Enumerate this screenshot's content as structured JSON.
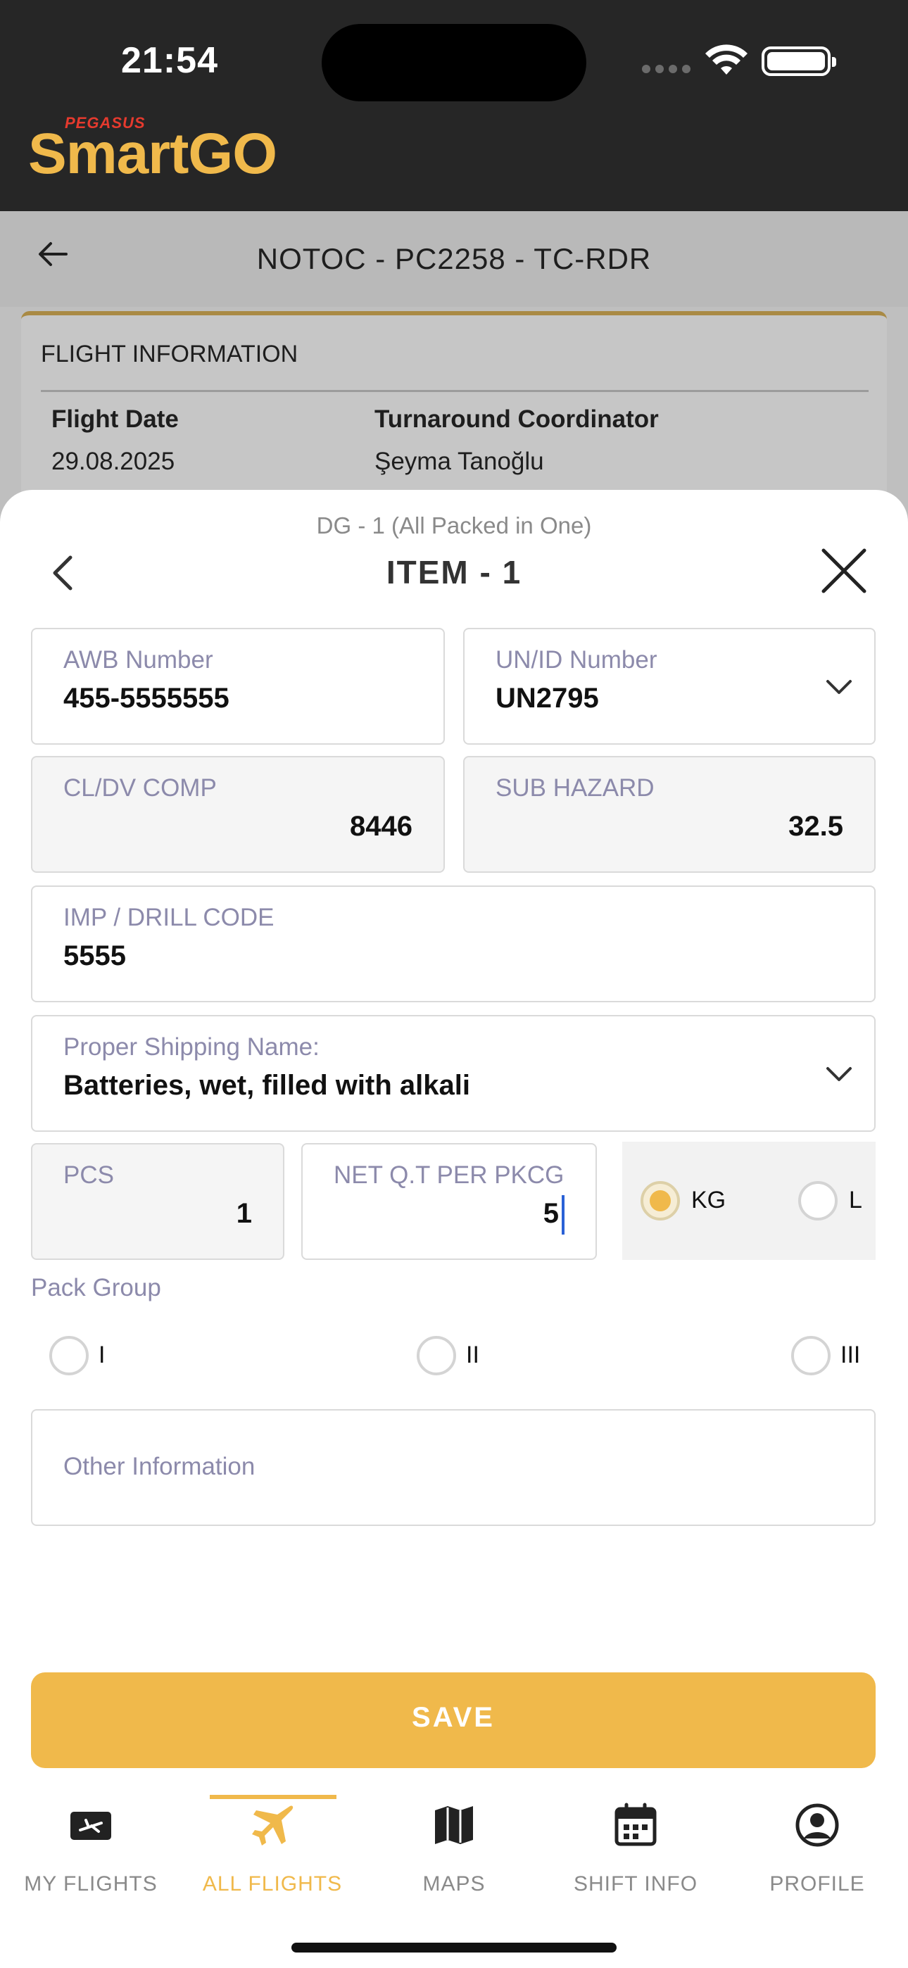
{
  "status_bar": {
    "time": "21:54"
  },
  "brand": {
    "top": "PEGASUS",
    "main": "SmartGO"
  },
  "page": {
    "title": "NOTOC - PC2258 - TC-RDR"
  },
  "flight_info": {
    "heading": "FLIGHT INFORMATION",
    "flight_date_label": "Flight Date",
    "flight_date": "29.08.2025",
    "coordinator_label": "Turnaround Coordinator",
    "coordinator": "Şeyma Tanoğlu"
  },
  "sheet": {
    "subtitle": "DG - 1 (All Packed in One)",
    "title": "ITEM - 1"
  },
  "fields": {
    "awb": {
      "label": "AWB Number",
      "value": "455-5555555"
    },
    "un_id": {
      "label": "UN/ID Number",
      "value": "UN2795"
    },
    "cl_dv": {
      "label": "CL/DV COMP",
      "value": "8446"
    },
    "sub_hazard": {
      "label": "SUB HAZARD",
      "value": "32.5"
    },
    "imp_drill": {
      "label": "IMP / DRILL CODE",
      "value": "5555"
    },
    "proper_name": {
      "label": "Proper Shipping Name:",
      "value": "Batteries, wet, filled with alkali"
    },
    "pcs": {
      "label": "PCS",
      "value": "1"
    },
    "net_qty": {
      "label": "NET Q.T PER PKCG",
      "value": "5"
    },
    "other": {
      "placeholder": "Other Information"
    }
  },
  "unit": {
    "options": [
      "KG",
      "L"
    ],
    "selected": "KG"
  },
  "pack_group": {
    "label": "Pack Group",
    "options": [
      "I",
      "II",
      "III"
    ],
    "selected": null
  },
  "save_label": "SAVE",
  "nav": {
    "tabs": [
      {
        "label": "MY FLIGHTS",
        "icon": "ticket-plane-icon"
      },
      {
        "label": "ALL FLIGHTS",
        "icon": "airplane-icon"
      },
      {
        "label": "MAPS",
        "icon": "map-icon"
      },
      {
        "label": "SHIFT INFO",
        "icon": "calendar-icon"
      },
      {
        "label": "PROFILE",
        "icon": "user-circle-icon"
      }
    ],
    "active": "ALL FLIGHTS"
  },
  "colors": {
    "accent": "#f0b94b",
    "header_bg": "#262626",
    "label": "#8c8aab"
  }
}
